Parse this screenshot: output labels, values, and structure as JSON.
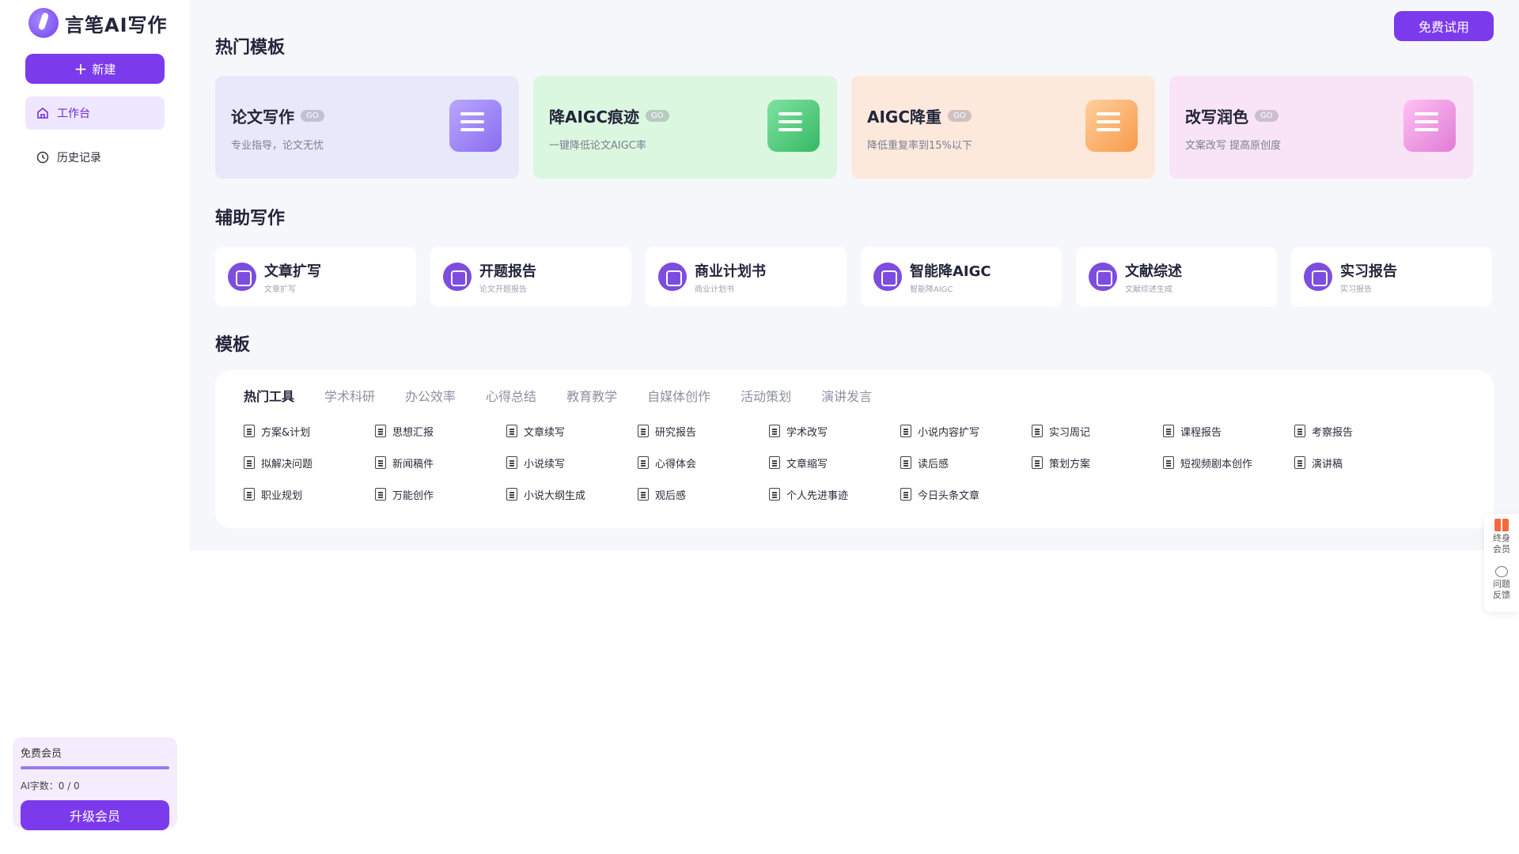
{
  "brand": {
    "name": "言笔AI写作"
  },
  "sidebar": {
    "new_label": "新建",
    "items": [
      {
        "label": "工作台",
        "icon": "home-icon",
        "active": true
      },
      {
        "label": "历史记录",
        "icon": "clock-icon",
        "active": false
      }
    ],
    "member": {
      "title": "免费会员",
      "quota": "AI字数：0 / 0",
      "progress": 1.0,
      "upgrade_label": "升级会员"
    }
  },
  "header": {
    "trial_label": "免费试用"
  },
  "sections": {
    "hot": "热门模板",
    "assist": "辅助写作",
    "templates": "模板"
  },
  "hot_cards": [
    {
      "title": "论文写作",
      "badge": "GO",
      "subtitle": "专业指导，论文无忧"
    },
    {
      "title": "降AIGC痕迹",
      "badge": "GO",
      "subtitle": "一键降低论文AIGC率"
    },
    {
      "title": "AIGC降重",
      "badge": "GO",
      "subtitle": "降低重复率到15%以下"
    },
    {
      "title": "改写润色",
      "badge": "GO",
      "subtitle": "文案改写 提高原创度"
    }
  ],
  "assist_cards": [
    {
      "title": "文章扩写",
      "subtitle": "文章扩写"
    },
    {
      "title": "开题报告",
      "subtitle": "论文开题报告"
    },
    {
      "title": "商业计划书",
      "subtitle": "商业计划书"
    },
    {
      "title": "智能降AIGC",
      "subtitle": "智能降AIGC"
    },
    {
      "title": "文献综述",
      "subtitle": "文献综述生成"
    },
    {
      "title": "实习报告",
      "subtitle": "实习报告"
    }
  ],
  "tabs": [
    {
      "label": "热门工具",
      "active": true
    },
    {
      "label": "学术科研",
      "active": false
    },
    {
      "label": "办公效率",
      "active": false
    },
    {
      "label": "心得总结",
      "active": false
    },
    {
      "label": "教育教学",
      "active": false
    },
    {
      "label": "自媒体创作",
      "active": false
    },
    {
      "label": "活动策划",
      "active": false
    },
    {
      "label": "演讲发言",
      "active": false
    }
  ],
  "templates": [
    "方案&计划",
    "思想汇报",
    "文章续写",
    "研究报告",
    "学术改写",
    "小说内容扩写",
    "实习周记",
    "课程报告",
    "考察报告",
    "拟解决问题",
    "新闻稿件",
    "小说续写",
    "心得体会",
    "文章缩写",
    "读后感",
    "策划方案",
    "短视频剧本创作",
    "演讲稿",
    "职业规划",
    "万能创作",
    "小说大纲生成",
    "观后感",
    "个人先进事迹",
    "今日头条文章"
  ],
  "float": {
    "member_label": "终身会员",
    "feedback_label": "问题反馈"
  }
}
